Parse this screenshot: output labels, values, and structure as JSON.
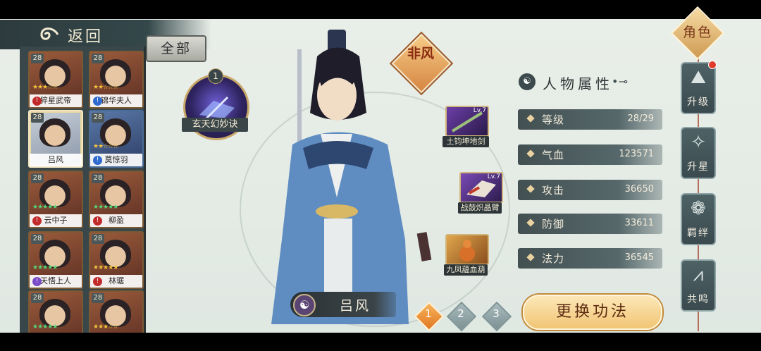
{
  "header": {
    "back_label": "返回",
    "filter_label": "全部"
  },
  "list": {
    "items": [
      {
        "name": "猝星武帝",
        "level": "28",
        "stars": "★★★☆☆",
        "star_color": "gold",
        "badge": "red",
        "theme": "red"
      },
      {
        "name": "锦华夫人",
        "level": "28",
        "stars": "★★☆☆☆",
        "star_color": "gold",
        "badge": "blue",
        "theme": "red"
      },
      {
        "name": "吕风",
        "level": "28",
        "stars": "",
        "star_color": "gold",
        "badge": "",
        "theme": "selected"
      },
      {
        "name": "莫惊羽",
        "level": "28",
        "stars": "★★☆☆☆",
        "star_color": "gold",
        "badge": "blue",
        "theme": "blue"
      },
      {
        "name": "云中子",
        "level": "28",
        "stars": "★★★★★",
        "star_color": "green",
        "badge": "red",
        "theme": "red"
      },
      {
        "name": "柳盈",
        "level": "28",
        "stars": "★★★★★",
        "star_color": "green",
        "badge": "red",
        "theme": "red"
      },
      {
        "name": "天悟上人",
        "level": "28",
        "stars": "★★★★★",
        "star_color": "green",
        "badge": "purple",
        "theme": "red"
      },
      {
        "name": "林琚",
        "level": "28",
        "stars": "★★★★★",
        "star_color": "gold",
        "badge": "red",
        "theme": "red"
      },
      {
        "name": "",
        "level": "28",
        "stars": "★★★★★",
        "star_color": "green",
        "badge": "",
        "theme": "red"
      },
      {
        "name": "",
        "level": "28",
        "stars": "★★★☆☆",
        "star_color": "gold",
        "badge": "",
        "theme": "red"
      }
    ]
  },
  "skill": {
    "number": "1",
    "name": "玄天幻妙诀"
  },
  "character": {
    "name": "吕风",
    "title_badge": "非风"
  },
  "equipment": [
    {
      "name": "土钧坤地剑",
      "level": "Lv.7"
    },
    {
      "name": "战鼓炽晶臂",
      "level": "Lv.7"
    },
    {
      "name": "九凤藴血葫",
      "level": ""
    }
  ],
  "attributes": {
    "heading": "人物属性",
    "rows": [
      {
        "label": "等级",
        "value": "28/29"
      },
      {
        "label": "气血",
        "value": "123571"
      },
      {
        "label": "攻击",
        "value": "36650"
      },
      {
        "label": "防御",
        "value": "33611"
      },
      {
        "label": "法力",
        "value": "36545"
      }
    ]
  },
  "nav": {
    "role_label": "角色",
    "items": [
      {
        "label": "升级",
        "glyph": "⛰"
      },
      {
        "label": "升星",
        "glyph": "✧"
      },
      {
        "label": "羁绊",
        "glyph": "❁"
      },
      {
        "label": "共鸣",
        "glyph": "⩘"
      }
    ]
  },
  "pages": [
    "1",
    "2",
    "3"
  ],
  "change_button": "更换功法"
}
